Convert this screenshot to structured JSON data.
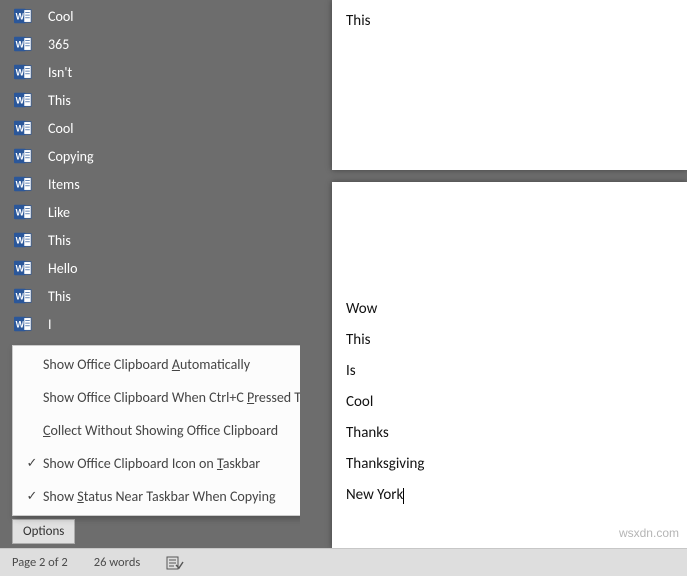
{
  "clipboard": {
    "items": [
      "Cool",
      "365",
      "Isn't",
      "This",
      "Cool",
      "Copying",
      "Items",
      "Like",
      "This",
      "Hello",
      "This",
      "I"
    ],
    "options_button": "Options",
    "menu": [
      {
        "checked": false,
        "label": "Show Office Clipboard Automatically",
        "ukey": "A",
        "post": "utomatically"
      },
      {
        "checked": false,
        "label": "Show Office Clipboard When Ctrl+C Pressed Twice",
        "ukey": "P",
        "post": "ressed Twice"
      },
      {
        "checked": false,
        "label": "Collect Without Showing Office Clipboard",
        "ukey": "C",
        "post": "ollect Without Showing Office Clipboard"
      },
      {
        "checked": true,
        "label": "Show Office Clipboard Icon on Taskbar",
        "ukey": "T",
        "post": "askbar"
      },
      {
        "checked": true,
        "label": "Show Status Near Taskbar When Copying",
        "ukey": "S",
        "post": "tatus Near Taskbar When Copying"
      }
    ]
  },
  "document": {
    "page1_lines": [
      "This"
    ],
    "page2_lines": [
      "Wow",
      "This",
      "Is",
      "Cool",
      "Thanks",
      "Thanksgiving",
      "New York"
    ]
  },
  "status": {
    "page": "Page 2 of 2",
    "words": "26 words"
  },
  "watermark": "wsxdn.com"
}
